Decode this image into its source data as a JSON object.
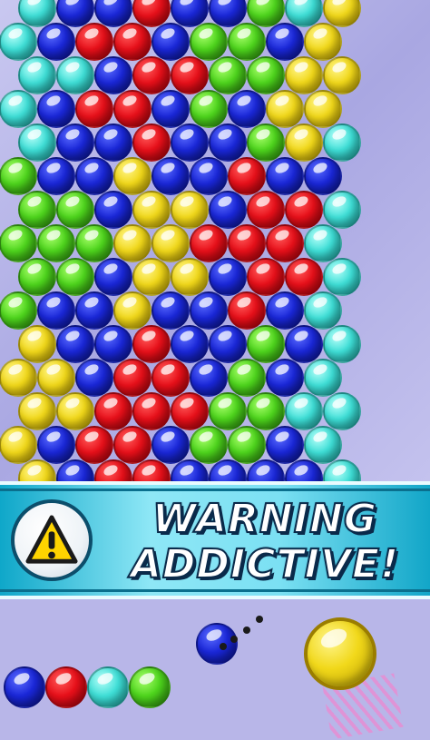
{
  "game": {
    "palette": {
      "R": "red",
      "B": "blue",
      "G": "green",
      "Y": "yellow",
      "C": "cyan"
    },
    "board_rows": [
      "CBBRBBGCY",
      "CBRRBGGBY",
      "CCBRRGGYY",
      "CBRRBGBYY",
      "CBBRBBGYC",
      "GBBYBBRBB",
      "GGBYYBRRC",
      "GGGYYRRRC",
      "GGBYYBRRC",
      "GBBYBBRBC",
      "YBBRBBGBC",
      "YYBRRBGBC",
      "YYRRRGGCC",
      "YBRRBGGBC",
      "YBRRBBBBC"
    ],
    "banner": {
      "line1": "WARNING",
      "line2": "ADDICTIVE!",
      "icon": "warning-triangle-icon",
      "colors": {
        "band": "#0fa7c9",
        "text": "#ffffff",
        "outline": "#0a2a4a",
        "triangle": "#ffd400"
      }
    },
    "shooter": {
      "current_bubble": "yellow",
      "next_bubble": "blue",
      "queue": [
        "blue",
        "red",
        "cyan",
        "green"
      ]
    }
  }
}
